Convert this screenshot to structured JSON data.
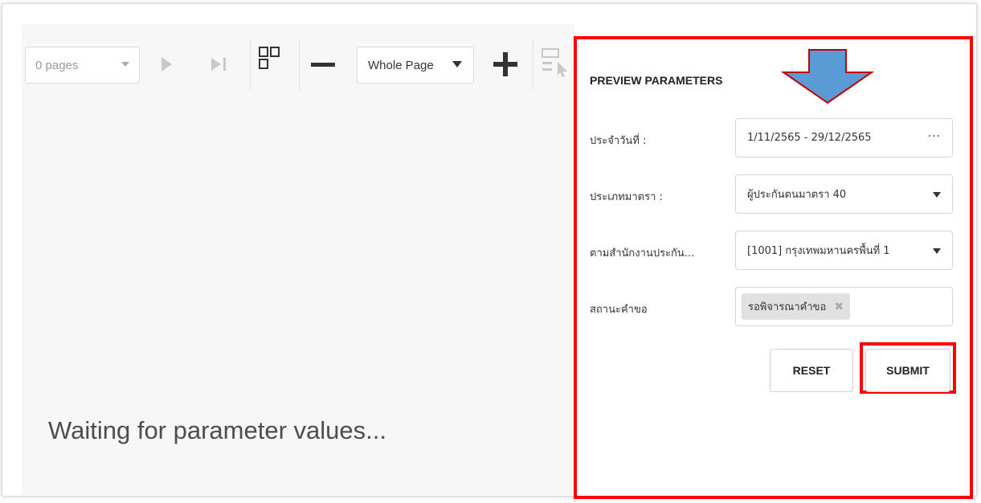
{
  "toolbar": {
    "pages_value": "0 pages",
    "zoom_value": "Whole Page"
  },
  "viewer": {
    "status_text": "Waiting for parameter values..."
  },
  "parameters": {
    "title": "PREVIEW PARAMETERS",
    "fields": [
      {
        "label": "ประจำวันที่ :",
        "value": "1/11/2565 - 29/12/2565",
        "control": "date-range"
      },
      {
        "label": "ประเภทมาตรา :",
        "value": "ผู้ประกันตนมาตรา 40",
        "control": "dropdown"
      },
      {
        "label": "ตามสำนักงานประกัน...",
        "value": "[1001] กรุงเทพมหานครพื้นที่ 1",
        "control": "dropdown"
      },
      {
        "label": "สถานะคำขอ",
        "tag": "รอพิจารณาคำขอ",
        "control": "tag-select"
      }
    ],
    "reset_label": "RESET",
    "submit_label": "SUBMIT"
  },
  "colors": {
    "highlight": "#ff0000",
    "arrow_fill": "#5b9bd5",
    "arrow_stroke": "#c00000"
  }
}
